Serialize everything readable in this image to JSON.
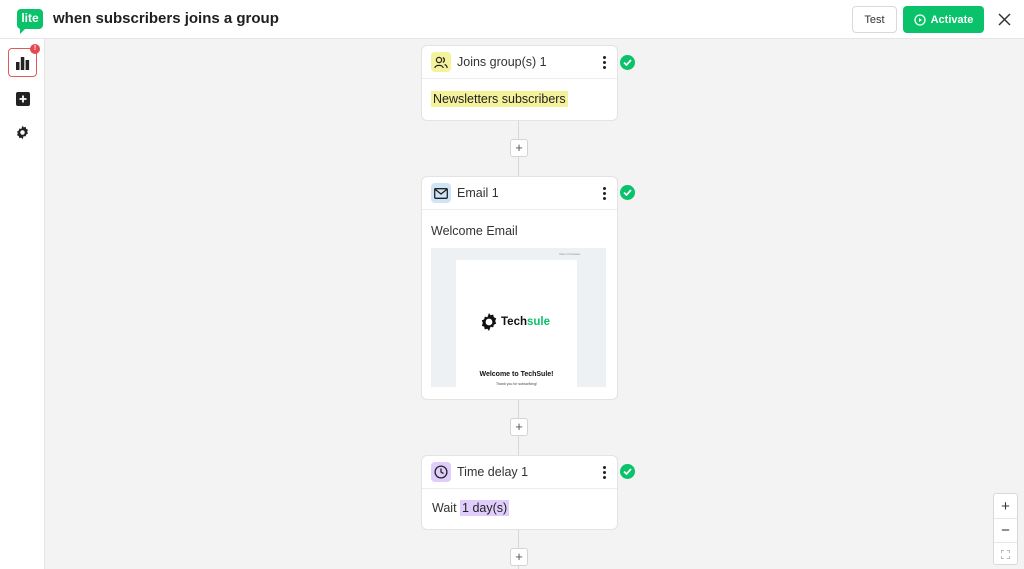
{
  "app": {
    "logo": "lite",
    "title": "when subscribers joins a group"
  },
  "toolbar": {
    "test_label": "Test",
    "activate_label": "Activate"
  },
  "sidebar": {
    "badge": "!",
    "items": [
      "stats-icon",
      "add-square-icon",
      "gear-icon"
    ]
  },
  "steps": {
    "trigger": {
      "title": "Joins group(s) 1",
      "group": "Newsletters subscribers"
    },
    "email": {
      "title": "Email 1",
      "subject": "Welcome Email",
      "preview": {
        "brand_a": "Tech",
        "brand_b": "sule",
        "headline": "Welcome to TechSule!",
        "subtext": "Thank you for subscribing!"
      }
    },
    "delay": {
      "title": "Time delay 1",
      "wait_label": "Wait",
      "duration": "1 day(s)"
    }
  },
  "zoom": {
    "in": "+",
    "out": "−"
  },
  "colors": {
    "accent": "#09c269",
    "trigger_icon_bg": "#f4f29a",
    "email_icon_bg": "#cfe4f6",
    "delay_icon_bg": "#e0cdfb",
    "badge": "#e5484d"
  }
}
